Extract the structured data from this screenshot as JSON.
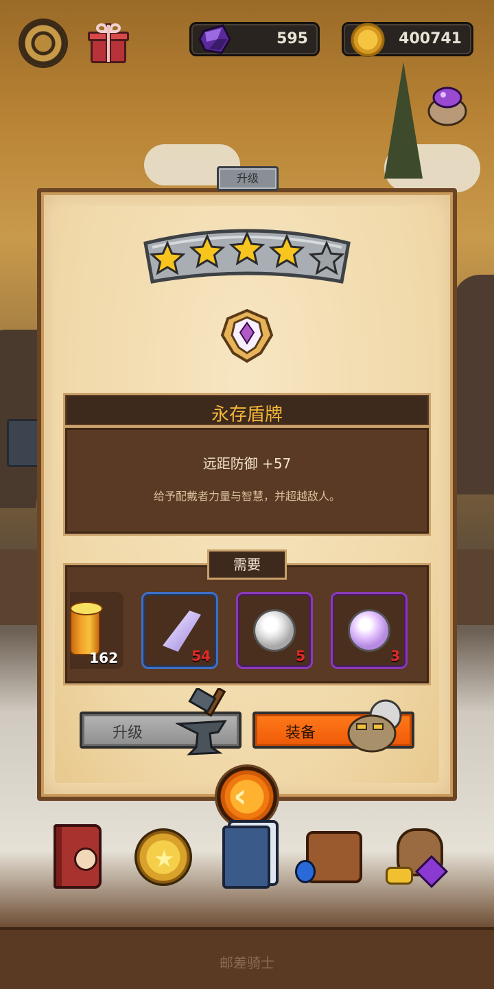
{
  "hud": {
    "gems": "595",
    "coins": "400741",
    "settings_icon": "gear-icon",
    "gift_icon": "gift-icon",
    "bag_icon": "gem-bag-icon"
  },
  "panel": {
    "tab_label": "升级",
    "stars_filled": 4,
    "stars_total": 5,
    "item_icon": "winged-shield-emblem-icon",
    "item_name": "永存盾牌",
    "stat_line": "远距防御 +57",
    "flavor_text": "给予配戴者力量与智慧，并超越敌人。",
    "requirements_label": "需要",
    "requirements": [
      {
        "icon": "gold-cylinder-icon",
        "count": "162",
        "count_color": "#ffffff"
      },
      {
        "icon": "crystal-shard-icon",
        "count": "54",
        "count_color": "#e02a2a",
        "rarity": "blue"
      },
      {
        "icon": "silver-orb-icon",
        "count": "5",
        "count_color": "#e02a2a",
        "rarity": "purple"
      },
      {
        "icon": "pink-orb-icon",
        "count": "3",
        "count_color": "#e02a2a",
        "rarity": "purple"
      }
    ],
    "upgrade_button": "升级",
    "equip_button": "装备",
    "back_icon": "back-chevron-icon"
  },
  "bottom_menu": [
    {
      "icon": "hero-book-icon"
    },
    {
      "icon": "star-medal-icon"
    },
    {
      "icon": "card-deck-icon"
    },
    {
      "icon": "satchel-icon"
    },
    {
      "icon": "loot-bag-icon"
    }
  ],
  "footer": "邮差骑士",
  "colors": {
    "title_gold": "#f3b73a",
    "equip_orange": "#ef5a08",
    "panel_parchment": "#f2dcaf",
    "count_red": "#e02a2a"
  }
}
